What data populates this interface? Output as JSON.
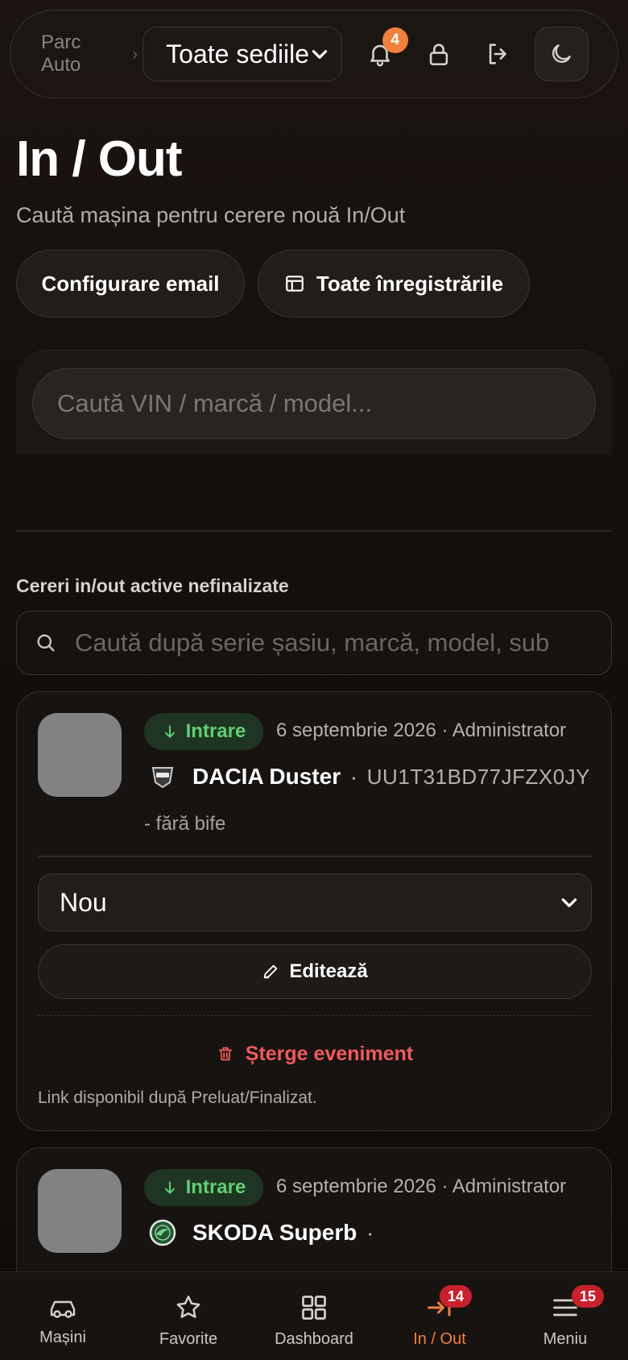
{
  "header": {
    "breadcrumb": "Parc Auto",
    "breadcrumb_separator": "›",
    "site_select_value": "Toate sediile",
    "notification_count": "4"
  },
  "page": {
    "title": "In / Out",
    "subtitle": "Caută mașina pentru cerere nouă In/Out"
  },
  "actions": {
    "email_config": "Configurare email",
    "all_records": "Toate înregistrările"
  },
  "search": {
    "placeholder": "Caută VIN / marcă / model..."
  },
  "active_requests": {
    "title": "Cereri in/out active nefinalizate",
    "filter_placeholder": "Caută după serie șasiu, marcă, model, sub"
  },
  "requests": [
    {
      "direction": "Intrare",
      "meta": "6 septembrie 2026 · Administrator",
      "brand_icon": "dacia-logo-icon",
      "car": "DACIA Duster",
      "separator": "·",
      "vin": "UU1T31BD77JFZX0JY",
      "checks": "- fără bife",
      "status": "Nou",
      "edit_label": "Editează",
      "delete_label": "Șterge eveniment",
      "link_note": "Link disponibil după Preluat/Finalizat."
    },
    {
      "direction": "Intrare",
      "meta": "6 septembrie 2026 · Administrator",
      "brand_icon": "skoda-logo-icon",
      "car": "SKODA Superb",
      "separator": "·"
    }
  ],
  "nav": {
    "items": [
      {
        "label": "Mașini",
        "icon": "car-icon"
      },
      {
        "label": "Favorite",
        "icon": "star-icon"
      },
      {
        "label": "Dashboard",
        "icon": "grid-icon"
      },
      {
        "label": "In / Out",
        "icon": "arrow-in-icon",
        "badge": "14",
        "active": true
      },
      {
        "label": "Meniu",
        "icon": "menu-icon",
        "badge": "15"
      }
    ]
  },
  "colors": {
    "accent": "#f0813a",
    "success": "#5fcf74",
    "danger": "#ef5a5a",
    "badge": "#c8212b"
  }
}
